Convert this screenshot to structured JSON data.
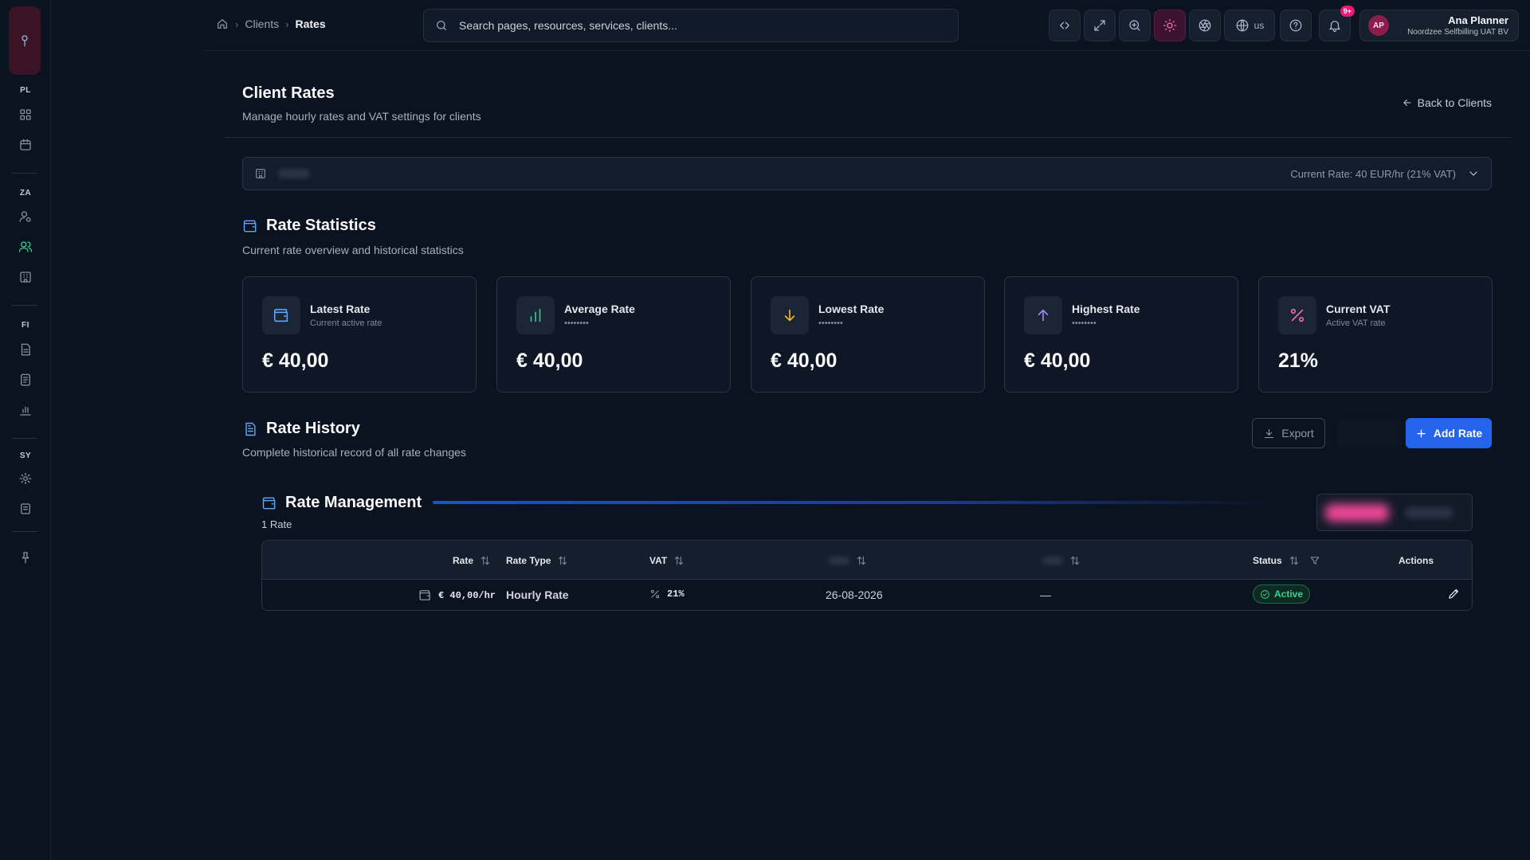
{
  "breadcrumb": {
    "items": [
      "Clients",
      "Rates"
    ]
  },
  "search": {
    "placeholder": "Search pages, resources, services, clients..."
  },
  "toolbar": {
    "locale": "us",
    "notifications_badge": "9+"
  },
  "user": {
    "initials": "AP",
    "name": "Ana Planner",
    "org": "Noordzee Selfbilling UAT BV"
  },
  "sidebar": {
    "sections": [
      "PL",
      "ZA",
      "FI",
      "SY"
    ]
  },
  "page": {
    "title": "Client Rates",
    "subtitle": "Manage hourly rates and VAT settings for clients",
    "back_label": "Back to Clients"
  },
  "client_select": {
    "rate_info": "Current Rate: 40 EUR/hr (21% VAT)"
  },
  "stats_section": {
    "title": "Rate Statistics",
    "subtitle": "Current rate overview and historical statistics"
  },
  "stats": [
    {
      "label": "Latest Rate",
      "sub": "Current active rate",
      "value": "€ 40,00",
      "icon": "wallet-icon",
      "color": "#60a5fa"
    },
    {
      "label": "Average Rate",
      "sub": "••••••••",
      "value": "€ 40,00",
      "icon": "bar-chart-icon",
      "color": "#34d399"
    },
    {
      "label": "Lowest Rate",
      "sub": "••••••••",
      "value": "€ 40,00",
      "icon": "arrow-down-icon",
      "color": "#fbbf24"
    },
    {
      "label": "Highest Rate",
      "sub": "••••••••",
      "value": "€ 40,00",
      "icon": "arrow-up-icon",
      "color": "#a78bfa"
    },
    {
      "label": "Current VAT",
      "sub": "Active VAT rate",
      "value": "21%",
      "icon": "percent-icon",
      "color": "#f472b6"
    }
  ],
  "history_section": {
    "title": "Rate History",
    "subtitle": "Complete historical record of all rate changes",
    "export_label": "Export",
    "add_label": "Add Rate"
  },
  "management": {
    "title": "Rate Management",
    "count": "1 Rate",
    "columns": {
      "rate": "Rate",
      "type": "Rate Type",
      "vat": "VAT",
      "status": "Status",
      "actions": "Actions"
    },
    "rows": [
      {
        "rate": "€ 40,00/hr",
        "type": "Hourly Rate",
        "vat": "21%",
        "date": "26-08-2026",
        "end": "—",
        "status": "Active"
      }
    ]
  }
}
